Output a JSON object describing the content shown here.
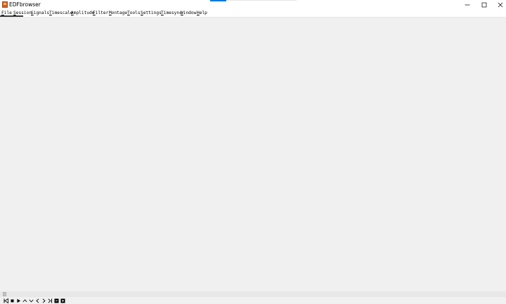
{
  "window": {
    "title": "EDFbrowser",
    "controls": {
      "minimize_icon": "minimize-icon",
      "maximize_icon": "maximize-icon",
      "close_icon": "close-icon"
    }
  },
  "menu": {
    "items": [
      {
        "accel": "F",
        "rest": "ile"
      },
      {
        "accel": "S",
        "rest": "ession"
      },
      {
        "accel": "S",
        "rest": "ignals"
      },
      {
        "accel": "T",
        "rest": "imescale"
      },
      {
        "accel": "A",
        "rest": "mplitude"
      },
      {
        "accel": "F",
        "rest": "ilter"
      },
      {
        "accel": "M",
        "rest": "ontage"
      },
      {
        "accel": "T",
        "rest": "ools"
      },
      {
        "accel": "S",
        "rest": "ettings"
      },
      {
        "accel": "T",
        "rest": "imesync"
      },
      {
        "accel": "W",
        "rest": "indow"
      },
      {
        "accel": "H",
        "rest": "elp"
      }
    ]
  },
  "toolbar": {
    "buttons": [
      "skip-to-start-icon",
      "stop-icon",
      "play-icon",
      "chevron-up-icon",
      "chevron-down-icon",
      "chevron-left-icon",
      "chevron-right-icon",
      "skip-to-end-icon",
      "zoom-out-icon",
      "zoom-in-icon"
    ]
  },
  "colors": {
    "app_icon": "#d0642a",
    "background": "#f0f0f0",
    "titlebar": "#ffffff",
    "accent": "#0078d7"
  }
}
